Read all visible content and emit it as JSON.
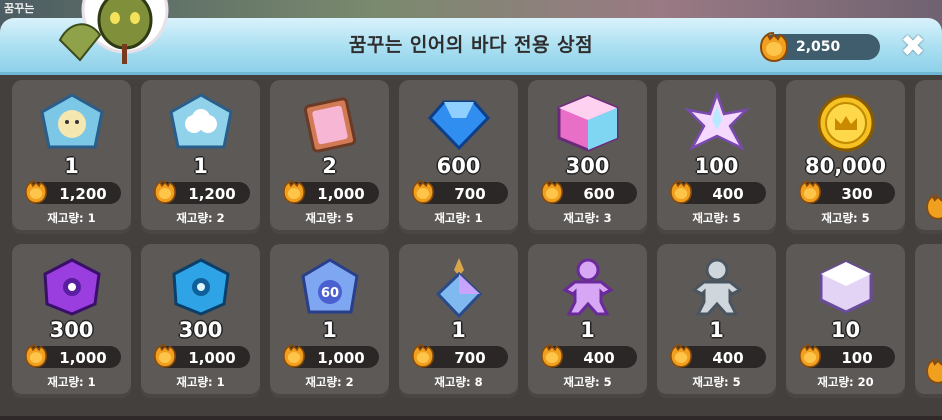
{
  "scene": {
    "corner_text": "꿈꾸는"
  },
  "shop": {
    "title": "꿈꾸는 인어의 바다 전용 상점",
    "currency_amount": "2,050",
    "currency_icon": "mermaid-coin-icon",
    "close_label": "✖"
  },
  "items": [
    {
      "icon": "dream-cookie-soulstone-icon",
      "qty": "1",
      "price": "1,200",
      "stock": "재고량: 1"
    },
    {
      "icon": "cloud-cookie-soulstone-icon",
      "qty": "1",
      "price": "1,200",
      "stock": "재고량: 2"
    },
    {
      "icon": "magic-frame-card-icon",
      "qty": "2",
      "price": "1,000",
      "stock": "재고량: 5"
    },
    {
      "icon": "blue-crystal-icon",
      "qty": "600",
      "price": "700",
      "stock": "재고량: 1"
    },
    {
      "icon": "rainbow-cube-icon",
      "qty": "300",
      "price": "600",
      "stock": "재고량: 3"
    },
    {
      "icon": "star-jewel-icon",
      "qty": "100",
      "price": "400",
      "stock": "재고량: 5"
    },
    {
      "icon": "gold-coin-icon",
      "qty": "80,000",
      "price": "300",
      "stock": "재고량: 5"
    },
    {
      "icon": "purple-magic-cube-icon",
      "qty": "300",
      "price": "1,000",
      "stock": "재고량: 1"
    },
    {
      "icon": "blue-magic-cube-icon",
      "qty": "300",
      "price": "1,000",
      "stock": "재고량: 1"
    },
    {
      "icon": "time-jumper-60-icon",
      "qty": "1",
      "price": "1,000",
      "stock": "재고량: 2"
    },
    {
      "icon": "crystal-shard-icon",
      "qty": "1",
      "price": "700",
      "stock": "재고량: 8"
    },
    {
      "icon": "purple-gingerbread-icon",
      "qty": "1",
      "price": "400",
      "stock": "재고량: 5"
    },
    {
      "icon": "silver-gingerbread-icon",
      "qty": "1",
      "price": "400",
      "stock": "재고량: 5"
    },
    {
      "icon": "lilac-cube-icon",
      "qty": "10",
      "price": "100",
      "stock": "재고량: 20"
    }
  ]
}
